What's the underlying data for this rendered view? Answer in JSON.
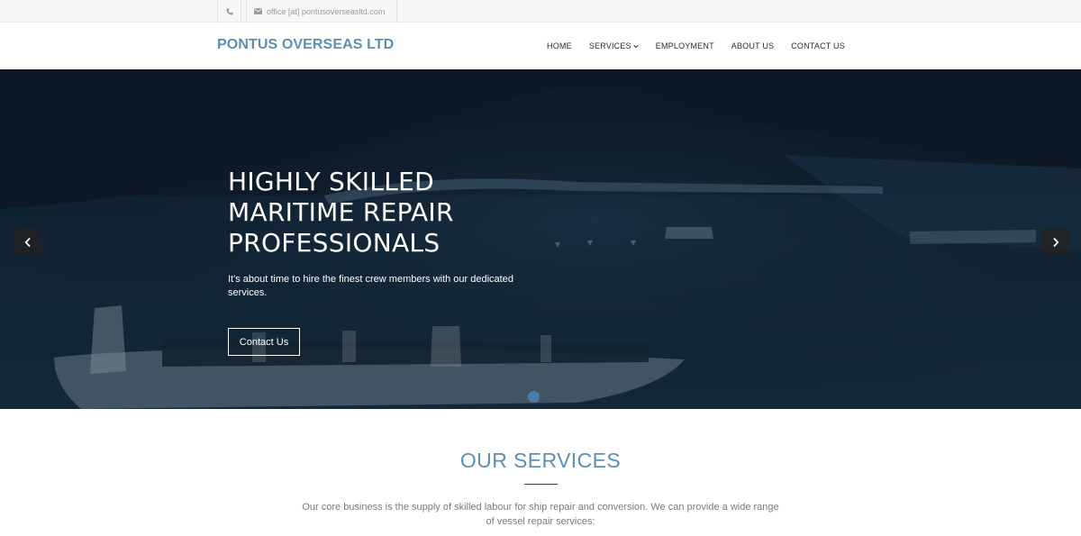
{
  "topbar": {
    "phone_icon": "phone-icon",
    "email_icon": "envelope-icon",
    "email": "office [at] pontusoverseasltd.com"
  },
  "header": {
    "logo": "PONTUS OVERSEAS LTD",
    "nav": [
      {
        "label": "HOME"
      },
      {
        "label": "SERVICES",
        "has_dropdown": true
      },
      {
        "label": "EMPLOYMENT"
      },
      {
        "label": "ABOUT US"
      },
      {
        "label": "CONTACT US"
      }
    ]
  },
  "hero": {
    "title_lines": [
      "HIGHLY SKILLED",
      "MARITIME REPAIR",
      "PROFESSIONALS"
    ],
    "subtitle": "It's about time to hire the finest crew members with our dedicated services.",
    "cta": "Contact Us",
    "prev_icon": "chevron-left-icon",
    "next_icon": "chevron-right-icon",
    "active_slide_color": "#4d7da6"
  },
  "services": {
    "heading": "OUR SERVICES",
    "intro": "Our core business is the supply of skilled labour for ship repair and conversion. We can provide a wide range of vessel repair services:"
  },
  "colors": {
    "brand": "#5d8fb2",
    "hero_overlay": "#14283a"
  }
}
